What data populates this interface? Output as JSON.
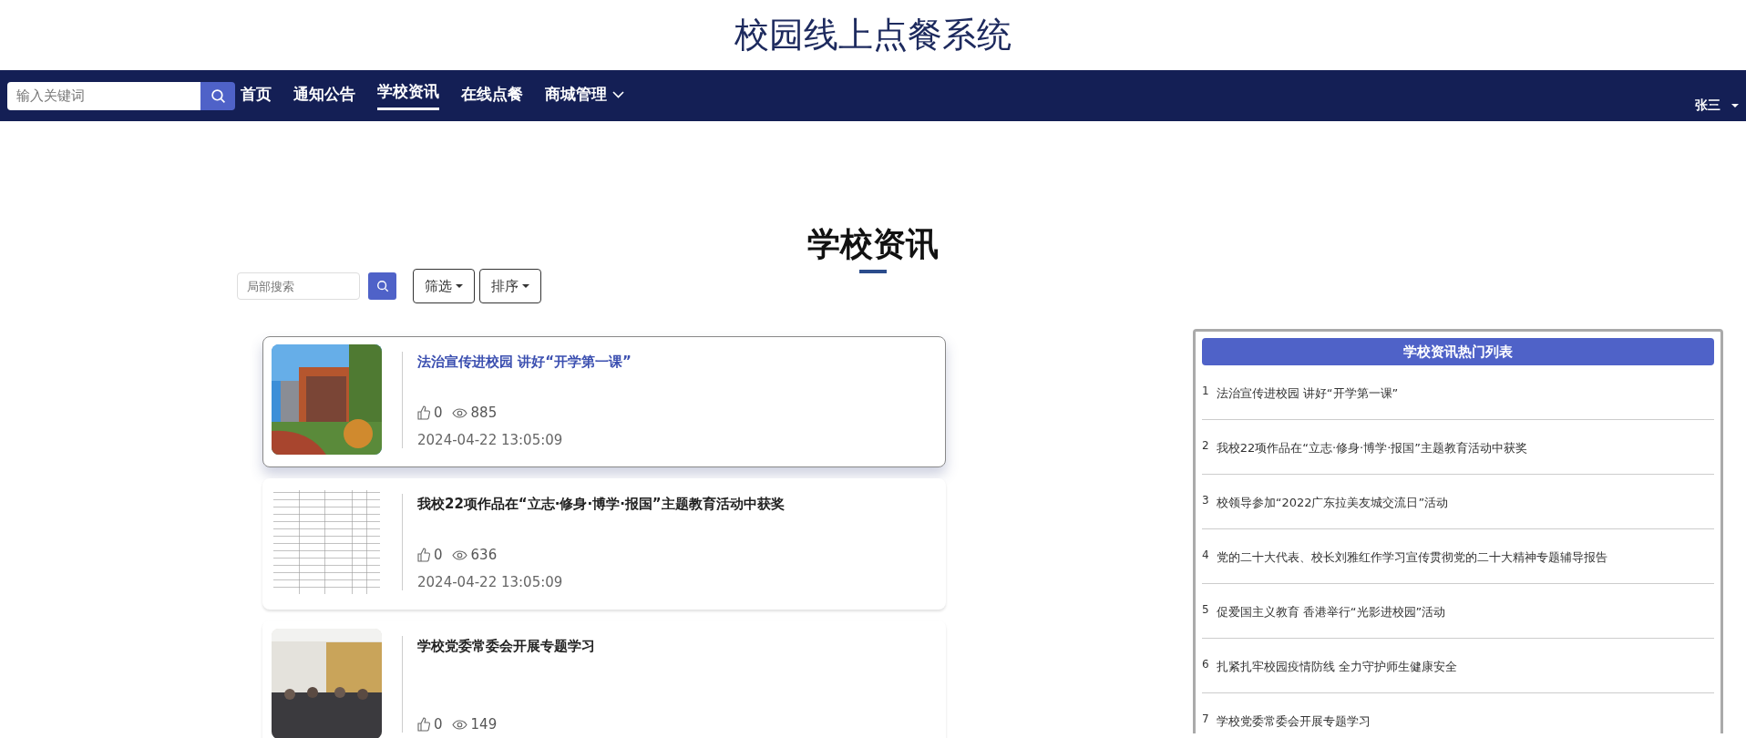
{
  "site_title": "校园线上点餐系统",
  "navbar": {
    "search": {
      "placeholder": "输入关键词"
    },
    "items": [
      {
        "label": "首页",
        "selected": false,
        "dropdown": false
      },
      {
        "label": "通知公告",
        "selected": false,
        "dropdown": false
      },
      {
        "label": "学校资讯",
        "selected": true,
        "dropdown": false
      },
      {
        "label": "在线点餐",
        "selected": false,
        "dropdown": false
      },
      {
        "label": "商城管理",
        "selected": false,
        "dropdown": true
      }
    ],
    "user": "张三"
  },
  "page_heading": "学校资讯",
  "filters": {
    "search": {
      "placeholder": "局部搜索"
    },
    "buttons": [
      "筛选",
      "排序"
    ]
  },
  "articles": [
    {
      "title": "法治宣传进校园 讲好“开学第一课”",
      "likes": "0",
      "views": "885",
      "date": "2024-04-22 13:05:09",
      "highlighted": true,
      "image": {
        "kind": "campus"
      }
    },
    {
      "title": "我校22项作品在“立志·修身·博学·报国”主题教育活动中获奖",
      "likes": "0",
      "views": "636",
      "date": "2024-04-22 13:05:09",
      "highlighted": false,
      "image": {
        "kind": "document"
      }
    },
    {
      "title": "学校党委常委会开展专题学习",
      "likes": "0",
      "views": "149",
      "highlighted": false,
      "image": {
        "kind": "meeting"
      }
    }
  ],
  "hot_list": {
    "title": "学校资讯热门列表",
    "items": [
      {
        "rank": "1",
        "title": "法治宣传进校园 讲好“开学第一课”"
      },
      {
        "rank": "2",
        "title": "我校22项作品在“立志·修身·博学·报国”主题教育活动中获奖"
      },
      {
        "rank": "3",
        "title": "校领导参加“2022广东拉美友城交流日”活动"
      },
      {
        "rank": "4",
        "title": "党的二十大代表、校长刘雅红作学习宣传贯彻党的二十大精神专题辅导报告"
      },
      {
        "rank": "5",
        "title": "促爱国主义教育 香港举行“光影进校园”活动"
      },
      {
        "rank": "6",
        "title": "扎紧扎牢校园疫情防线 全力守护师生健康安全"
      },
      {
        "rank": "7",
        "title": "学校党委常委会开展专题学习"
      }
    ]
  }
}
